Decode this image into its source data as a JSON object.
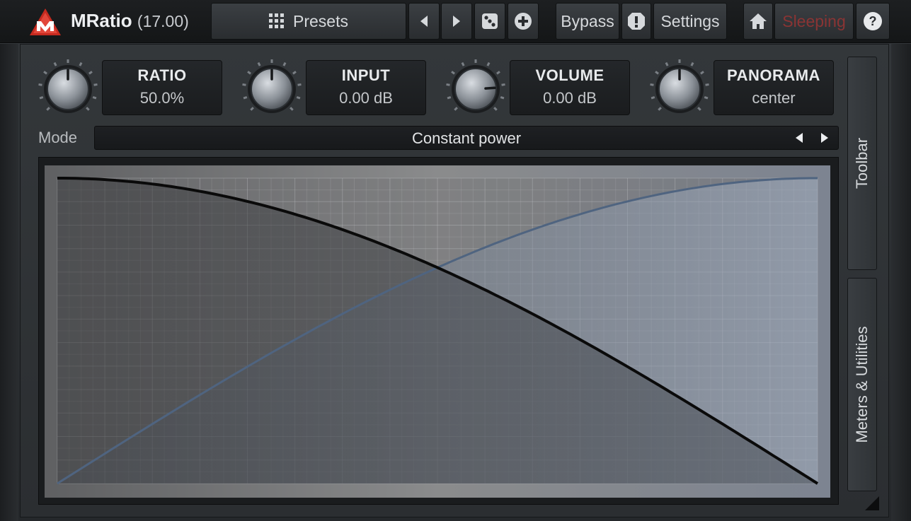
{
  "header": {
    "logo_icon": "m-logo-icon",
    "plugin_name": "MRatio",
    "version": "(17.00)",
    "presets_label": "Presets",
    "bypass_label": "Bypass",
    "settings_label": "Settings",
    "status_label": "Sleeping",
    "icons": [
      "grid-icon",
      "prev-arrow-icon",
      "next-arrow-icon",
      "dice-icon",
      "plus-circle-icon",
      "alert-icon",
      "home-icon",
      "help-icon"
    ]
  },
  "params": [
    {
      "name": "RATIO",
      "value": "50.0%",
      "level": 0.5
    },
    {
      "name": "INPUT",
      "value": "0.00 dB",
      "level": 0.5
    },
    {
      "name": "VOLUME",
      "value": "0.00 dB",
      "level": 0.82
    },
    {
      "name": "PANORAMA",
      "value": "center",
      "level": 0.5
    }
  ],
  "mode": {
    "label": "Mode",
    "value": "Constant power"
  },
  "side_tabs": {
    "toolbar": "Toolbar",
    "meters": "Meters & Utilities"
  },
  "colors": {
    "accent_red": "#c62a1f",
    "status_sleeping": "#8a3434",
    "curve_primary": "#0a0a0a",
    "curve_secondary": "#4f6480"
  }
}
